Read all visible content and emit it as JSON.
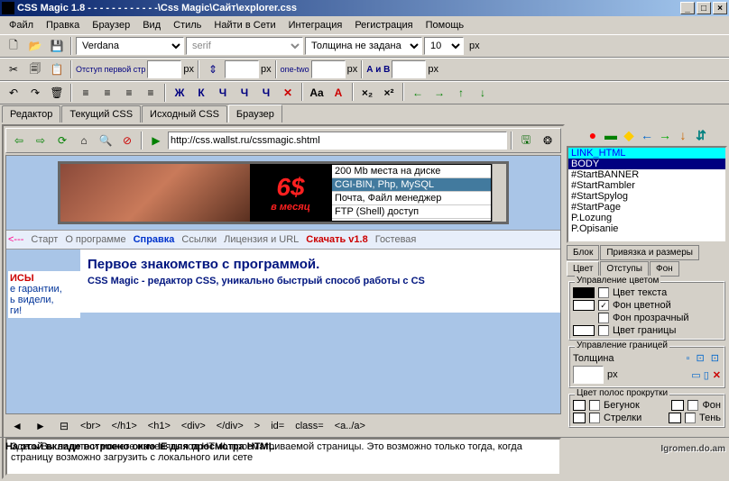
{
  "window": {
    "title": "CSS Magic 1.8 - - - - - - - - - - - -\\Css Magic\\Сайт\\explorer.css",
    "min": "_",
    "max": "□",
    "close": "×"
  },
  "menu": [
    "Файл",
    "Правка",
    "Браузер",
    "Вид",
    "Стиль",
    "Найти в Сети",
    "Интеграция",
    "Регистрация",
    "Помощь"
  ],
  "toolbar1": {
    "font_family": "Verdana",
    "generic_family": "serif",
    "thickness": "Толщина не задана",
    "size": "10",
    "unit": "px"
  },
  "toolbar2": {
    "label1": "Отступ первой стр",
    "unit1": "px",
    "unit2": "px",
    "onetwo": "one-two",
    "unit3": "px",
    "ab": "А и В",
    "unit4": "px"
  },
  "toolbar3": {
    "btns": [
      "Ж",
      "К",
      "Ч",
      "Ч",
      "Ч",
      "✕",
      "Aa",
      "A",
      "×₂",
      "×²",
      "←",
      "→",
      "↑",
      "↓"
    ]
  },
  "main_tabs": [
    "Редактор",
    "Текущий CSS",
    "Исходный CSS",
    "Браузер"
  ],
  "main_tabs_active": 3,
  "nav": {
    "url": "http://css.wallst.ru/cssmagic.shtml"
  },
  "banner": {
    "price": "6$",
    "period": "в месяц",
    "items": [
      "200 Mb места на диске",
      "CGI-BIN, Php, MySQL",
      "Почта, Файл менеджер",
      "FTP (Shell) доступ"
    ]
  },
  "navlinks": {
    "arrow": "<---",
    "items": [
      "Старт",
      "О программе",
      "Справка",
      "Ссылки",
      "Лицензия и URL",
      "Скачать v1.8",
      "Гостевая"
    ]
  },
  "content": {
    "h": "Первое знакомство с программой.",
    "sub": "CSS Magic - редактор CSS, уникально быстрый способ работы с CS",
    "side1": "ИСЫ",
    "side2": "е гарантии,",
    "side3": "ь видели,",
    "side4": "ги!"
  },
  "html_toolbar": [
    "<br>",
    "</h1>",
    "<h1>",
    "<div>",
    "</div>",
    ">",
    "id=",
    "class=",
    "<a../a>"
  ],
  "html_text": "Здесь Вы видите и можете изменять код HTML просматриваемой страницы.\nЭто возможно только тогда, когда страницу возможно загрузить с локального или сете",
  "right_tb_colors": [
    "#ff0000",
    "#008000",
    "#ffcc00",
    "#0066cc",
    "#00aa00",
    "#cc6600",
    "#008080"
  ],
  "tree": [
    "LINK_HTML",
    "BODY",
    "#StartBANNER",
    "#StartRambler",
    "#StartSpylog",
    "#StartPage",
    "P.Lozung",
    "P.Opisanie"
  ],
  "tree_sel": 1,
  "props_tabs": [
    "Блок",
    "Привязка и размеры",
    "Цвет",
    "Отступы",
    "Фон"
  ],
  "props_tabs_active": 2,
  "colorgrp": {
    "title": "Управление цветом",
    "r1": "Цвет текста",
    "r2": "Фон цветной",
    "r3": "Фон прозрачный",
    "r4": "Цвет границы"
  },
  "bordergrp": {
    "title": "Управление границей",
    "thick": "Толщина",
    "unit": "px"
  },
  "scrollgrp": {
    "title": "Цвет полос прокрутки",
    "r1": "Бегунок",
    "r2": "Фон",
    "r3": "Стрелки",
    "r4": "Тень"
  },
  "status": "На этой вкладе встроено окно IE для просмотра HTML",
  "watermark": "Igromen.do.am"
}
